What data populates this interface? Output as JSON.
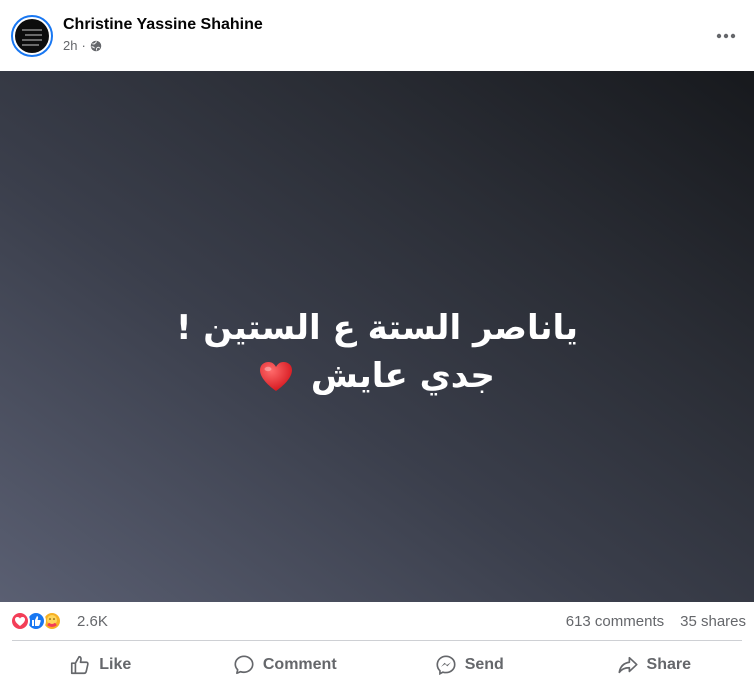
{
  "post": {
    "author": "Christine Yassine Shahine",
    "time": "2h",
    "separator": "·",
    "privacy_icon": "globe-icon",
    "more_icon": "more-options-icon",
    "text_line1": "ياناصر الستة ع الستين !",
    "text_line2": "جدي عايش",
    "text_emoji": "red-heart-icon"
  },
  "reactions": {
    "icons": [
      "love-icon",
      "like-icon",
      "care-icon"
    ],
    "count": "2.6K",
    "comments": "613 comments",
    "shares": "35 shares"
  },
  "actions": {
    "like": "Like",
    "comment": "Comment",
    "send": "Send",
    "share": "Share"
  },
  "colors": {
    "accent": "#1877f2",
    "secondary_text": "#65676b",
    "love": "#f33e58",
    "care": "#f7b125"
  }
}
